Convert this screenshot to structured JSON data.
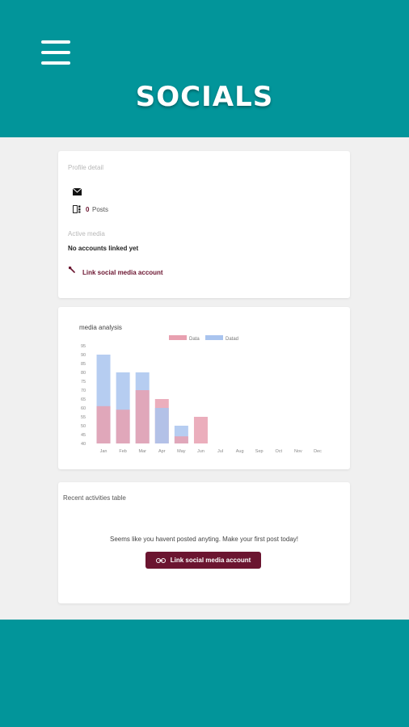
{
  "header": {
    "title": "SOCIALS"
  },
  "profile": {
    "section_title": "Profile detail",
    "posts_count": "0",
    "posts_label": "Posts",
    "active_media_label": "Active media",
    "no_accounts": "No accounts linked yet",
    "link_label": "Link social media account"
  },
  "chart_card": {
    "title": "media analysis"
  },
  "chart_data": {
    "type": "bar",
    "stacked": false,
    "overlay": true,
    "categories": [
      "Jan",
      "Feb",
      "Mar",
      "Apr",
      "May",
      "Jun",
      "Jul",
      "Aug",
      "Sep",
      "Oct",
      "Nov",
      "Dec"
    ],
    "series": [
      {
        "name": "Data",
        "color": "#e8a0b0",
        "values": [
          61,
          59,
          70,
          65,
          44,
          55,
          null,
          null,
          null,
          null,
          null,
          null
        ]
      },
      {
        "name": "Datad",
        "color": "#a9c4ee",
        "values": [
          90,
          80,
          80,
          60,
          50,
          null,
          null,
          null,
          null,
          null,
          null,
          null
        ]
      }
    ],
    "ylim": [
      40,
      95
    ],
    "yticks": [
      "95",
      "90",
      "85",
      "80",
      "75",
      "70",
      "65",
      "60",
      "55",
      "50",
      "45",
      "40"
    ],
    "legend": "top"
  },
  "activities": {
    "title": "Recent activities table",
    "empty_message": "Seems like you havent posted anyting. Make your first post today!",
    "button_label": "Link social media account"
  },
  "colors": {
    "teal": "#02959a",
    "maroon": "#6b1530"
  }
}
